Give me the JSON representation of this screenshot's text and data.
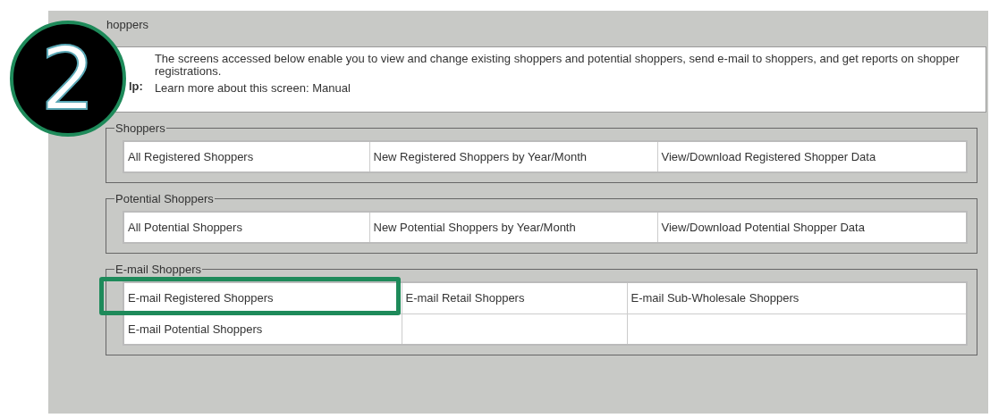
{
  "step_badge": {
    "number": "2"
  },
  "panel": {
    "title": "hoppers"
  },
  "help": {
    "label": "lp:",
    "text": "The screens accessed below enable you to view and change existing shoppers and potential shoppers, send e-mail to shoppers, and get reports on shopper registrations.",
    "manual": "Learn more about this screen: Manual"
  },
  "groups": [
    {
      "legend": "Shoppers",
      "rows": [
        [
          {
            "label": "All Registered Shoppers",
            "highlighted": false
          },
          {
            "label": "New Registered Shoppers by Year/Month",
            "highlighted": false
          },
          {
            "label": "View/Download Registered Shopper Data",
            "highlighted": false
          }
        ]
      ]
    },
    {
      "legend": "Potential Shoppers",
      "rows": [
        [
          {
            "label": "All Potential Shoppers",
            "highlighted": false
          },
          {
            "label": "New Potential Shoppers by Year/Month",
            "highlighted": false
          },
          {
            "label": "View/Download Potential Shopper Data",
            "highlighted": false
          }
        ]
      ]
    },
    {
      "legend": "E-mail Shoppers",
      "rows": [
        [
          {
            "label": "E-mail Registered Shoppers",
            "highlighted": true
          },
          {
            "label": "E-mail Retail Shoppers",
            "highlighted": false
          },
          {
            "label": "E-mail Sub-Wholesale Shoppers",
            "highlighted": false
          }
        ],
        [
          {
            "label": "E-mail Potential Shoppers",
            "highlighted": false
          },
          {
            "highlighted": false
          },
          {
            "highlighted": false
          }
        ]
      ]
    }
  ]
}
